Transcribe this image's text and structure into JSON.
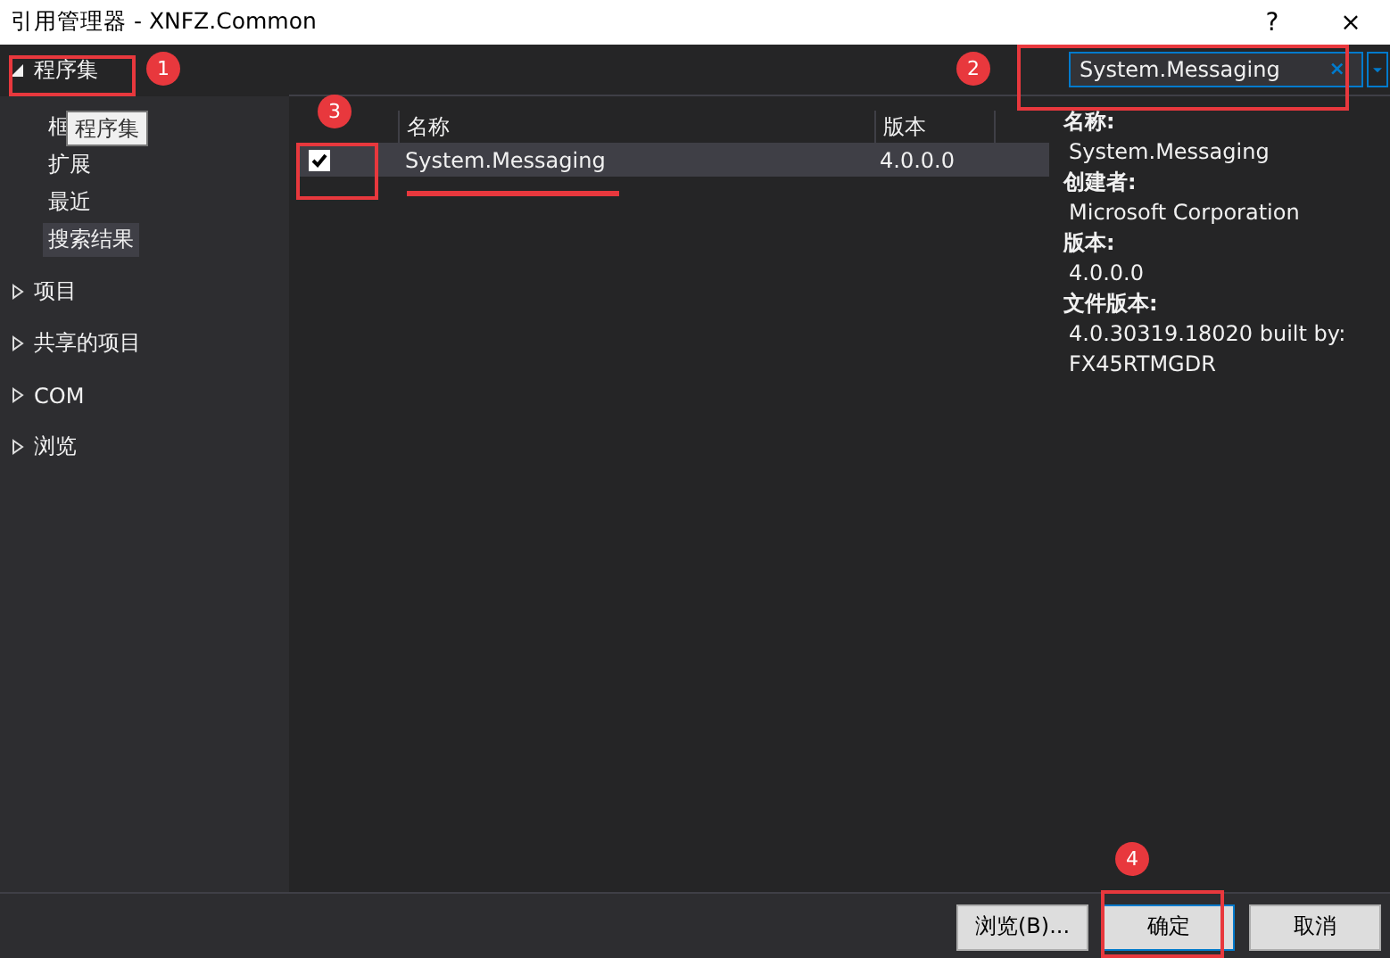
{
  "window": {
    "title": "引用管理器 - XNFZ.Common",
    "help": "?",
    "close": "×"
  },
  "sidebar": {
    "items": [
      {
        "label": "程序集",
        "expanded": true,
        "children": [
          {
            "label": "框",
            "selected": false
          },
          {
            "label": "扩展",
            "selected": false
          },
          {
            "label": "最近",
            "selected": false
          },
          {
            "label": "搜索结果",
            "selected": true
          }
        ]
      },
      {
        "label": "项目",
        "expanded": false
      },
      {
        "label": "共享的项目",
        "expanded": false
      },
      {
        "label": "COM",
        "expanded": false
      },
      {
        "label": "浏览",
        "expanded": false
      }
    ]
  },
  "tooltip": "程序集",
  "search": {
    "value": "System.Messaging",
    "clear": "×"
  },
  "table": {
    "columns": [
      "名称",
      "版本"
    ],
    "rows": [
      {
        "checked": true,
        "selected": true,
        "name": "System.Messaging",
        "version": "4.0.0.0"
      }
    ]
  },
  "details": [
    {
      "label": "名称:",
      "value": "System.Messaging"
    },
    {
      "label": "创建者:",
      "value": "Microsoft Corporation"
    },
    {
      "label": "版本:",
      "value": "4.0.0.0"
    },
    {
      "label": "文件版本:",
      "value": "4.0.30319.18020 built by: FX45RTMGDR"
    }
  ],
  "buttons": [
    {
      "label": "浏览(B)...",
      "selected": false
    },
    {
      "label": "确定",
      "selected": true
    },
    {
      "label": "取消",
      "selected": false
    }
  ],
  "annotations": [
    "1",
    "2",
    "3",
    "4"
  ]
}
